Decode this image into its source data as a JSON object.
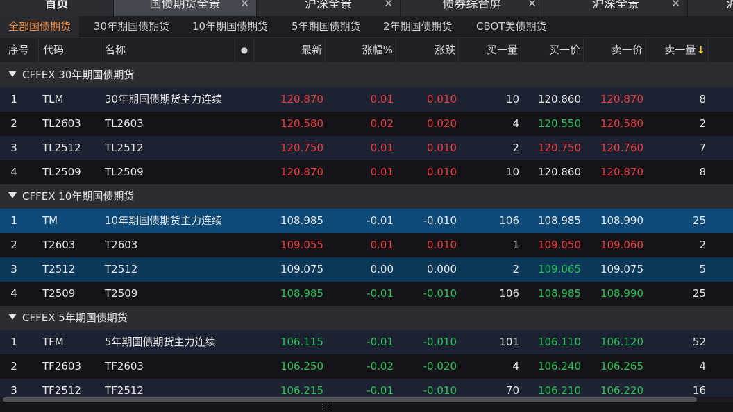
{
  "tabs": [
    {
      "label": "首页",
      "closable": false
    },
    {
      "label": "国债期货全景",
      "closable": true,
      "active": true
    },
    {
      "label": "沪深全景",
      "closable": true
    },
    {
      "label": "债券综合屏",
      "closable": true
    },
    {
      "label": "沪深全景",
      "closable": true
    },
    {
      "label": "沪",
      "closable": false
    }
  ],
  "close_glyph": "✕",
  "subtabs": [
    "全部国债期货",
    "30年期国债期货",
    "10年期国债期货",
    "5年期国债期货",
    "2年期国债期货",
    "CBOT美债期货"
  ],
  "columns": {
    "no": "序号",
    "code": "代码",
    "name": "名称",
    "dot": "●",
    "last": "最新",
    "pct": "涨幅%",
    "chg": "涨跌",
    "bvol": "买一量",
    "bid": "买一价",
    "ask": "卖一价",
    "avol": "卖一量",
    "sort_arrow": "↓"
  },
  "groups": [
    {
      "title": "CFFEX 30年期国债期货",
      "rows": [
        {
          "no": "1",
          "code": "TLM",
          "name": "30年期国债期货主力连续",
          "last": "120.870",
          "pct": "0.01",
          "chg": "0.010",
          "bvol": "10",
          "bid": "120.860",
          "ask": "120.870",
          "avol": "8",
          "c_last": "red",
          "c_pct": "red",
          "c_chg": "red",
          "c_bid": "white",
          "c_ask": "red",
          "bg": "a"
        },
        {
          "no": "2",
          "code": "TL2603",
          "name": "TL2603",
          "last": "120.580",
          "pct": "0.02",
          "chg": "0.020",
          "bvol": "4",
          "bid": "120.550",
          "ask": "120.580",
          "avol": "2",
          "c_last": "red",
          "c_pct": "red",
          "c_chg": "red",
          "c_bid": "green",
          "c_ask": "red",
          "bg": "b"
        },
        {
          "no": "3",
          "code": "TL2512",
          "name": "TL2512",
          "last": "120.750",
          "pct": "0.01",
          "chg": "0.010",
          "bvol": "2",
          "bid": "120.750",
          "ask": "120.760",
          "avol": "7",
          "c_last": "red",
          "c_pct": "red",
          "c_chg": "red",
          "c_bid": "red",
          "c_ask": "red",
          "bg": "a"
        },
        {
          "no": "4",
          "code": "TL2509",
          "name": "TL2509",
          "last": "120.870",
          "pct": "0.01",
          "chg": "0.010",
          "bvol": "10",
          "bid": "120.860",
          "ask": "120.870",
          "avol": "8",
          "c_last": "red",
          "c_pct": "red",
          "c_chg": "red",
          "c_bid": "white",
          "c_ask": "red",
          "bg": "b"
        }
      ]
    },
    {
      "title": "CFFEX 10年期国债期货",
      "rows": [
        {
          "no": "1",
          "code": "TM",
          "name": "10年期国债期货主力连续",
          "last": "108.985",
          "pct": "-0.01",
          "chg": "-0.010",
          "bvol": "106",
          "bid": "108.985",
          "ask": "108.990",
          "avol": "25",
          "c_last": "white",
          "c_pct": "white",
          "c_chg": "white",
          "c_bid": "white",
          "c_ask": "white",
          "bg": "sel"
        },
        {
          "no": "2",
          "code": "T2603",
          "name": "T2603",
          "last": "109.055",
          "pct": "0.01",
          "chg": "0.010",
          "bvol": "1",
          "bid": "109.050",
          "ask": "109.060",
          "avol": "2",
          "c_last": "red",
          "c_pct": "red",
          "c_chg": "red",
          "c_bid": "red",
          "c_ask": "red",
          "bg": "b"
        },
        {
          "no": "3",
          "code": "T2512",
          "name": "T2512",
          "last": "109.075",
          "pct": "0.00",
          "chg": "0.000",
          "bvol": "2",
          "bid": "109.065",
          "ask": "109.075",
          "avol": "5",
          "c_last": "white",
          "c_pct": "white",
          "c_chg": "white",
          "c_bid": "green",
          "c_ask": "white",
          "bg": "sel2"
        },
        {
          "no": "4",
          "code": "T2509",
          "name": "T2509",
          "last": "108.985",
          "pct": "-0.01",
          "chg": "-0.010",
          "bvol": "106",
          "bid": "108.985",
          "ask": "108.990",
          "avol": "25",
          "c_last": "green",
          "c_pct": "green",
          "c_chg": "green",
          "c_bid": "green",
          "c_ask": "green",
          "bg": "b"
        }
      ]
    },
    {
      "title": "CFFEX 5年期国债期货",
      "rows": [
        {
          "no": "1",
          "code": "TFM",
          "name": "5年期国债期货主力连续",
          "last": "106.115",
          "pct": "-0.01",
          "chg": "-0.010",
          "bvol": "101",
          "bid": "106.110",
          "ask": "106.120",
          "avol": "52",
          "c_last": "green",
          "c_pct": "green",
          "c_chg": "green",
          "c_bid": "green",
          "c_ask": "green",
          "bg": "a"
        },
        {
          "no": "2",
          "code": "TF2603",
          "name": "TF2603",
          "last": "106.250",
          "pct": "-0.02",
          "chg": "-0.020",
          "bvol": "4",
          "bid": "106.240",
          "ask": "106.265",
          "avol": "4",
          "c_last": "green",
          "c_pct": "green",
          "c_chg": "green",
          "c_bid": "green",
          "c_ask": "green",
          "bg": "b"
        },
        {
          "no": "3",
          "code": "TF2512",
          "name": "TF2512",
          "last": "106.215",
          "pct": "-0.01",
          "chg": "-0.010",
          "bvol": "70",
          "bid": "106.210",
          "ask": "106.220",
          "avol": "16",
          "c_last": "green",
          "c_pct": "green",
          "c_chg": "green",
          "c_bid": "green",
          "c_ask": "green",
          "bg": "a"
        }
      ]
    }
  ],
  "colors": {
    "up": "#ef3b3b",
    "down": "#27c553",
    "accent": "#f08a3c",
    "selected_row": "#0d4a78"
  },
  "bottom_grip": "⋮⋮"
}
